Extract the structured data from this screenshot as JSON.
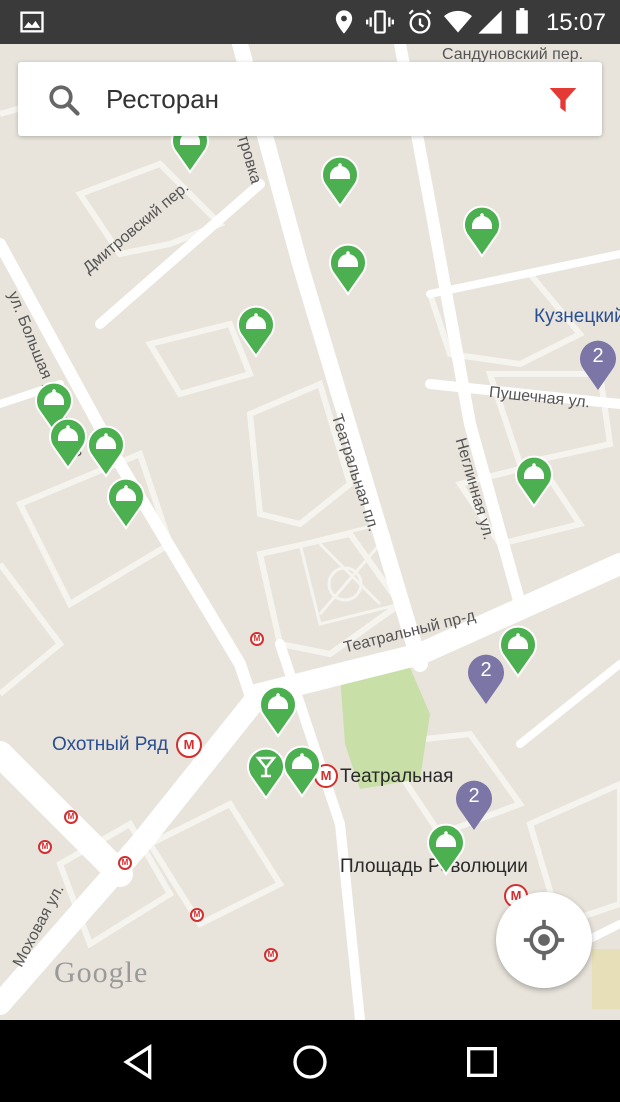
{
  "status_bar": {
    "time": "15:07",
    "icons": [
      "image-icon",
      "location-icon",
      "vibrate-icon",
      "alarm-icon",
      "wifi-icon",
      "signal-icon",
      "battery-icon"
    ]
  },
  "search": {
    "query": "Ресторан",
    "search_icon": "search-icon",
    "filter_icon": "filter-icon",
    "filter_color": "#e53935"
  },
  "map": {
    "street_labels": [
      "Сандуновский пер.",
      "Дмитровский пер.",
      "ул. Большая Дмитровка",
      "Петровка",
      "Театральная пл.",
      "Неглинная ул.",
      "Пушечная ул.",
      "Театральный пр-д",
      "Моховая ул."
    ],
    "metro_labels": [
      "Кузнецкий",
      "Охотный Ряд",
      "Театральная",
      "Площадь Революции"
    ],
    "clusters": [
      "2",
      "2",
      "2"
    ],
    "pin_color": "#4caf50",
    "cluster_color": "#7b76a6",
    "attribution": "Google"
  },
  "locate_button": {
    "icon": "my-location-icon"
  },
  "nav_bar": {
    "icons": [
      "back-icon",
      "home-icon",
      "recents-icon"
    ]
  }
}
